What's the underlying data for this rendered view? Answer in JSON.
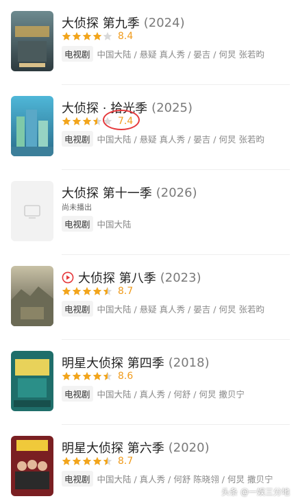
{
  "items": [
    {
      "title": "大侦探 第九季",
      "year": "(2024)",
      "score": "8.4",
      "stars": [
        "full",
        "full",
        "full",
        "full",
        "empty"
      ],
      "badge": "电视剧",
      "tags": "中国大陆 / 悬疑 真人秀 / 晏吉 / 何炅 张若昀",
      "poster": "poster-dz9"
    },
    {
      "title": "大侦探 · 拾光季",
      "year": "(2025)",
      "score": "7.4",
      "stars": [
        "full",
        "full",
        "full",
        "half",
        "empty"
      ],
      "badge": "电视剧",
      "tags": "中国大陆 / 悬疑 真人秀 / 晏吉 / 何炅 张若昀",
      "poster": "poster-sgj"
    },
    {
      "title": "大侦探 第十一季",
      "year": "(2026)",
      "subtitle": "尚未播出",
      "badge": "电视剧",
      "tags": "中国大陆",
      "poster": "poster-placeholder"
    },
    {
      "title": "大侦探 第八季",
      "year": "(2023)",
      "score": "8.7",
      "stars": [
        "full",
        "full",
        "full",
        "full",
        "half"
      ],
      "badge": "电视剧",
      "tags": "中国大陆 / 悬疑 真人秀 / 晏吉 / 何炅 张若昀",
      "poster": "poster-dz8",
      "play_icon": "play-circle-icon"
    },
    {
      "title": "明星大侦探 第四季",
      "year": "(2018)",
      "score": "8.6",
      "stars": [
        "full",
        "full",
        "full",
        "full",
        "half"
      ],
      "badge": "电视剧",
      "tags": "中国大陆 / 真人秀 / 何舒 / 何炅 撒贝宁",
      "poster": "poster-mx4"
    },
    {
      "title": "明星大侦探 第六季",
      "year": "(2020)",
      "score": "8.7",
      "stars": [
        "full",
        "full",
        "full",
        "full",
        "half"
      ],
      "badge": "电视剧",
      "tags": "中国大陆 / 真人秀 / 何舒 陈晓翎 / 何炅 撒贝宁",
      "poster": "poster-mx6"
    }
  ],
  "watermark": "头条 @一娱三分地",
  "colors": {
    "star": "#f2a51c",
    "score": "#f09b1c",
    "annotation": "#e5383b",
    "play": "#e5383b"
  }
}
